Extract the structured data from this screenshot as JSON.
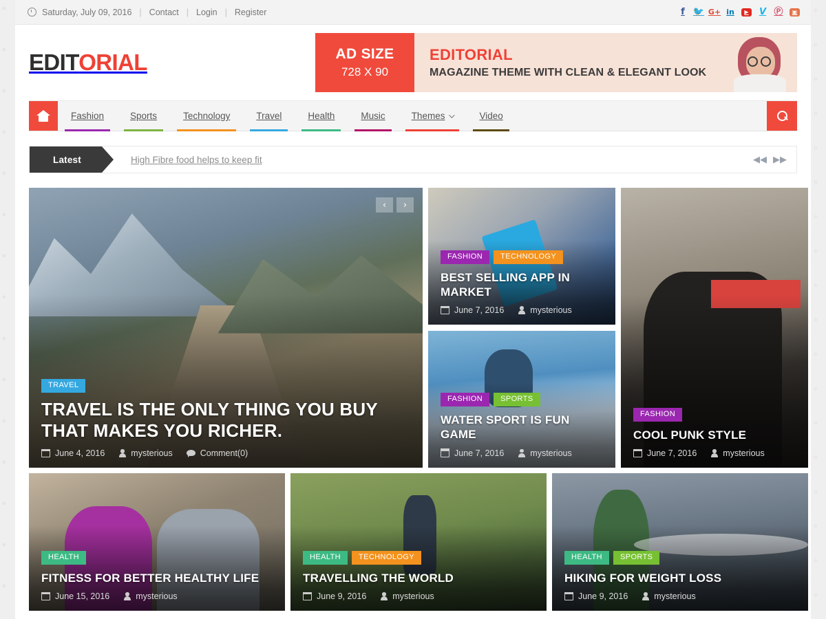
{
  "topbar": {
    "clock_icon": "clock-icon",
    "date": "Saturday, July 09, 2016",
    "sep": "|",
    "links": [
      {
        "label": "Contact"
      },
      {
        "label": "Login"
      },
      {
        "label": "Register"
      }
    ],
    "socials": [
      {
        "name": "facebook-icon",
        "glyph": "f",
        "color": "#3b5998"
      },
      {
        "name": "twitter-icon",
        "glyph": "🐦",
        "color": "#2ca8e0"
      },
      {
        "name": "google-plus-icon",
        "glyph": "G+",
        "color": "#dd4b39"
      },
      {
        "name": "linkedin-icon",
        "glyph": "in",
        "color": "#0077b5"
      },
      {
        "name": "youtube-icon",
        "glyph": "▶",
        "color": "#e02a20"
      },
      {
        "name": "vimeo-icon",
        "glyph": "V",
        "color": "#1ab7ea"
      },
      {
        "name": "pinterest-icon",
        "glyph": "Ⓟ",
        "color": "#d6536c"
      },
      {
        "name": "instagram-icon",
        "glyph": "▣",
        "color": "#e4734a"
      }
    ]
  },
  "header": {
    "logo_dark": "EDIT",
    "logo_red": "ORIAL",
    "ad": {
      "size_line1": "AD SIZE",
      "size_line2": "728 X 90",
      "title": "EDITORIAL",
      "subtitle": "MAGAZINE THEME WITH CLEAN & ELEGANT LOOK"
    }
  },
  "nav": {
    "home_icon": "home-icon",
    "search_icon": "search-icon",
    "items": [
      {
        "label": "Fashion",
        "color": "#9b27b0",
        "dropdown": false
      },
      {
        "label": "Sports",
        "color": "#7cb342",
        "dropdown": false
      },
      {
        "label": "Technology",
        "color": "#f3921e",
        "dropdown": false
      },
      {
        "label": "Travel",
        "color": "#35a8e0",
        "dropdown": false
      },
      {
        "label": "Health",
        "color": "#3dba84",
        "dropdown": false
      },
      {
        "label": "Music",
        "color": "#b31267",
        "dropdown": false
      },
      {
        "label": "Themes",
        "color": "#ef4136",
        "dropdown": true
      },
      {
        "label": "Video",
        "color": "#5c4a10",
        "dropdown": false
      }
    ]
  },
  "ticker": {
    "label": "Latest",
    "text": "High Fibre food helps to keep fit",
    "prev_icon": "prev-double-arrow-icon",
    "next_icon": "next-double-arrow-icon",
    "prev_glyph": "◀◀",
    "next_glyph": "▶▶"
  },
  "slider": {
    "prev_glyph": "‹",
    "next_glyph": "›"
  },
  "colors": {
    "brand_red": "#ef4136",
    "tag_travel": "#35a8e0",
    "tag_fashion": "#9b27b0",
    "tag_technology": "#f3921e",
    "tag_sports": "#77c033",
    "tag_health": "#3dba84"
  },
  "articles": [
    {
      "id": "travel-hero",
      "tags": [
        {
          "label": "TRAVEL",
          "color": "#35a8e0"
        }
      ],
      "title": "TRAVEL IS THE ONLY THING YOU BUY THAT MAKES YOU RICHER.",
      "date": "June 4, 2016",
      "author": "mysterious",
      "comments": "Comment(0)"
    },
    {
      "id": "best-selling-app",
      "tags": [
        {
          "label": "FASHION",
          "color": "#9b27b0"
        },
        {
          "label": "TECHNOLOGY",
          "color": "#f3921e"
        }
      ],
      "title": "BEST SELLING APP IN MARKET",
      "date": "June 7, 2016",
      "author": "mysterious"
    },
    {
      "id": "cool-punk-style",
      "tags": [
        {
          "label": "FASHION",
          "color": "#9b27b0"
        }
      ],
      "title": "COOL PUNK STYLE",
      "date": "June 7, 2016",
      "author": "mysterious"
    },
    {
      "id": "water-sport",
      "tags": [
        {
          "label": "FASHION",
          "color": "#9b27b0"
        },
        {
          "label": "SPORTS",
          "color": "#77c033"
        }
      ],
      "title": "WATER SPORT IS FUN GAME",
      "date": "June 7, 2016",
      "author": "mysterious"
    },
    {
      "id": "fitness-healthy-life",
      "tags": [
        {
          "label": "HEALTH",
          "color": "#3dba84"
        }
      ],
      "title": "FITNESS FOR BETTER HEALTHY LIFE",
      "date": "June 15, 2016",
      "author": "mysterious"
    },
    {
      "id": "travelling-the-world",
      "tags": [
        {
          "label": "HEALTH",
          "color": "#3dba84"
        },
        {
          "label": "TECHNOLOGY",
          "color": "#f3921e"
        }
      ],
      "title": "TRAVELLING THE WORLD",
      "date": "June 9, 2016",
      "author": "mysterious"
    },
    {
      "id": "hiking-weight-loss",
      "tags": [
        {
          "label": "HEALTH",
          "color": "#3dba84"
        },
        {
          "label": "SPORTS",
          "color": "#77c033"
        }
      ],
      "title": "HIKING FOR WEIGHT LOSS",
      "date": "June 9, 2016",
      "author": "mysterious"
    }
  ]
}
